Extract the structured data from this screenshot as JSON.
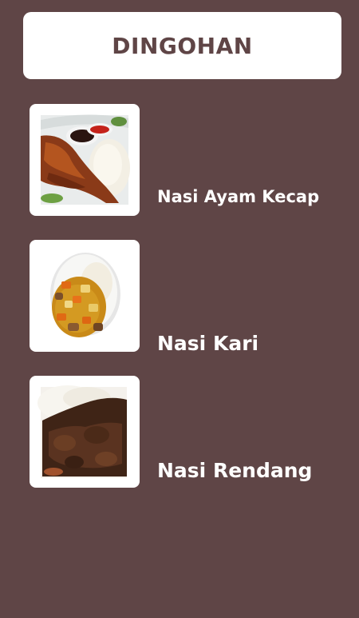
{
  "header": {
    "title": "DINGOHAN"
  },
  "menu": {
    "items": [
      {
        "name": "Nasi Ayam Kecap",
        "image_icon": "chicken-rice-image"
      },
      {
        "name": "Nasi Kari",
        "image_icon": "curry-rice-image"
      },
      {
        "name": "Nasi Rendang",
        "image_icon": "rendang-rice-image"
      }
    ]
  },
  "colors": {
    "background": "#5f4546",
    "card": "#ffffff",
    "title_text": "#5f4546",
    "item_text": "#ffffff"
  }
}
